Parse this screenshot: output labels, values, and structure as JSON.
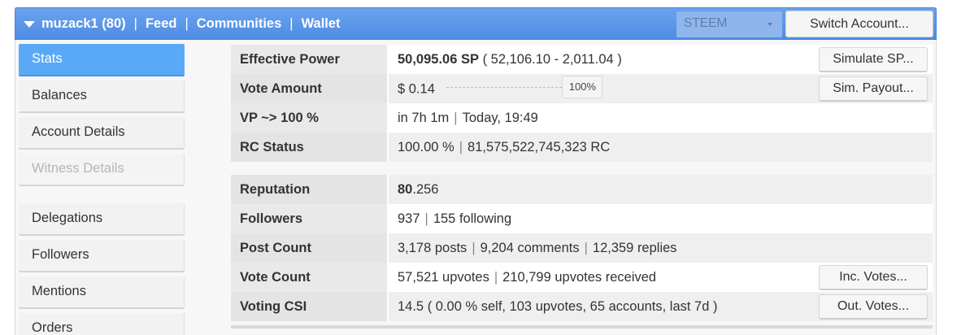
{
  "header": {
    "nav": [
      {
        "label": "muzack1 (80)"
      },
      {
        "label": "Feed"
      },
      {
        "label": "Communities"
      },
      {
        "label": "Wallet"
      }
    ],
    "chain_select": {
      "value": "STEEM"
    },
    "switch_account_label": "Switch Account..."
  },
  "sidebar": {
    "items": [
      {
        "label": "Stats"
      },
      {
        "label": "Balances"
      },
      {
        "label": "Account Details"
      },
      {
        "label": "Witness Details"
      },
      {
        "label": "Delegations"
      },
      {
        "label": "Followers"
      },
      {
        "label": "Mentions"
      },
      {
        "label": "Orders"
      }
    ]
  },
  "stats": {
    "effective_power": {
      "label": "Effective Power",
      "value_bold": "50,095.06 SP",
      "value_rest": " ( 52,106.10 - 2,011.04 )",
      "button": "Simulate SP..."
    },
    "vote_amount": {
      "label": "Vote Amount",
      "value": "$ 0.14",
      "slider_percent": "100%",
      "button": "Sim. Payout..."
    },
    "vp": {
      "label": "VP ~> 100 %",
      "time": "in 7h 1m",
      "when": "Today, 19:49"
    },
    "rc": {
      "label": "RC Status",
      "percent": "100.00 %",
      "amount": "81,575,522,745,323 RC"
    },
    "reputation": {
      "label": "Reputation",
      "whole": "80",
      "fraction": ".256"
    },
    "followers": {
      "label": "Followers",
      "count": "937",
      "following": "155 following"
    },
    "post_count": {
      "label": "Post Count",
      "posts": "3,178 posts",
      "comments": "9,204 comments",
      "replies": "12,359 replies"
    },
    "vote_count": {
      "label": "Vote Count",
      "upvotes": "57,521 upvotes",
      "received": "210,799 upvotes received",
      "button": "Inc. Votes..."
    },
    "voting_csi": {
      "label": "Voting CSI",
      "value": "14.5 ( 0.00 % self, 103 upvotes, 65 accounts, last 7d )",
      "button": "Out. Votes..."
    }
  }
}
